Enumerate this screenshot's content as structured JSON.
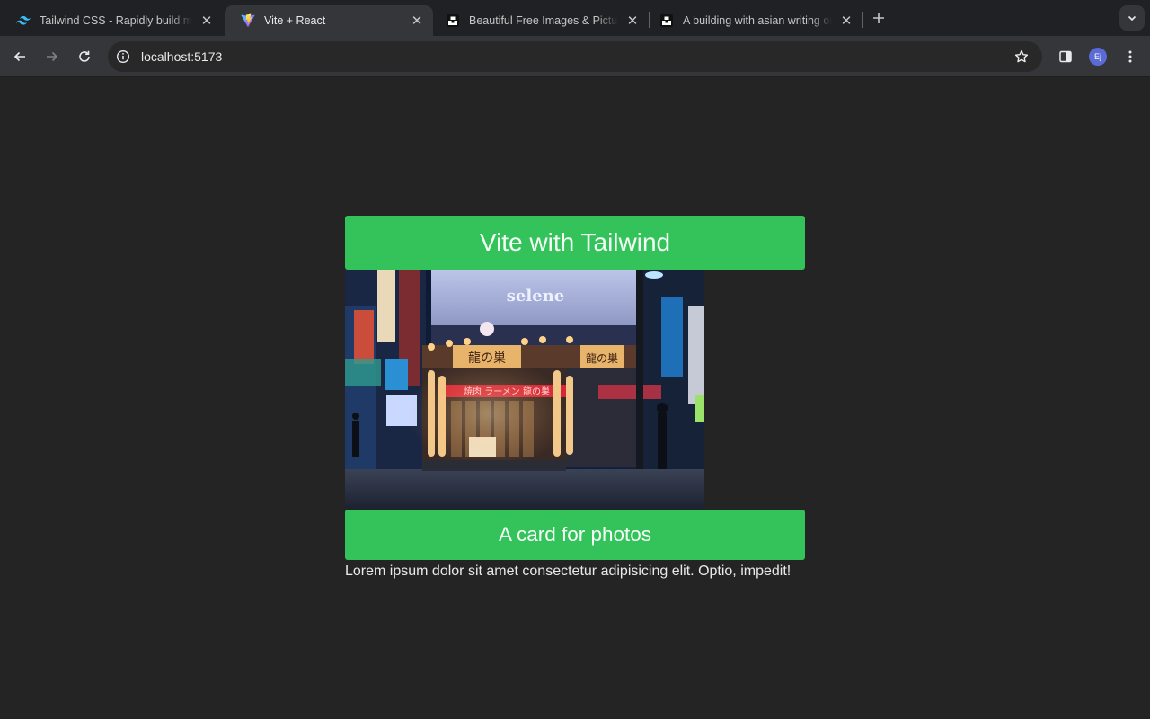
{
  "browser": {
    "tabs": [
      {
        "title": "Tailwind CSS - Rapidly build modern websites",
        "icon": "tailwind-icon",
        "active": false
      },
      {
        "title": "Vite + React",
        "icon": "vite-icon",
        "active": true
      },
      {
        "title": "Beautiful Free Images & Pictures",
        "icon": "unsplash-icon",
        "active": false
      },
      {
        "title": "A building with asian writing on it",
        "icon": "unsplash-icon",
        "active": false
      }
    ],
    "address": "localhost:5173",
    "profile_initials": "Ej"
  },
  "page": {
    "heading": "Vite with Tailwind",
    "card": {
      "title": "A card for photos",
      "text": "Lorem ipsum dolor sit amet consectetur adipisicing elit. Optio, impedit!",
      "image_alt": "A building with asian writing on it"
    },
    "colors": {
      "background": "#242424",
      "accent": "#34c35a"
    }
  }
}
